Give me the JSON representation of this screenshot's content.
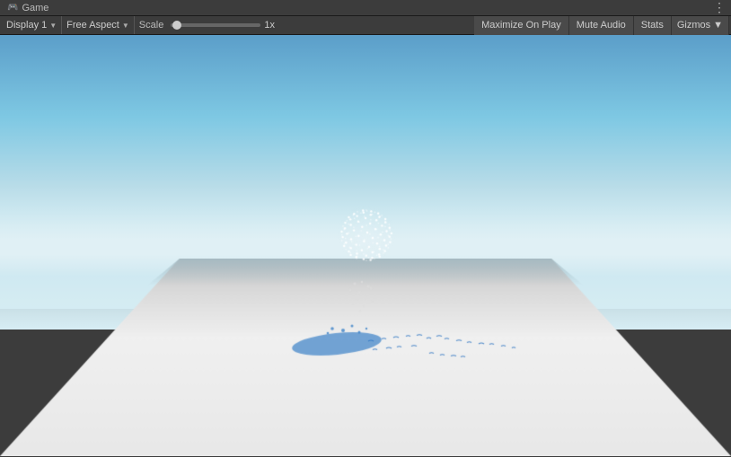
{
  "tab": {
    "icon": "🎮",
    "label": "Game",
    "more_icon": "⋮"
  },
  "toolbar": {
    "display_label": "Display 1",
    "display_arrow": "▼",
    "aspect_label": "Free Aspect",
    "aspect_arrow": "▼",
    "scale_label": "Scale",
    "scale_value": "1x",
    "maximize_label": "Maximize On Play",
    "mute_label": "Mute Audio",
    "stats_label": "Stats",
    "gizmos_label": "Gizmos",
    "gizmos_arrow": "▼"
  },
  "colors": {
    "sky_top": "#5b9ec9",
    "sky_horizon": "#cde8f0",
    "ground_light": "#f0f0f0",
    "ground_dark": "#888888",
    "accent_blue": "#4a9fd4"
  }
}
